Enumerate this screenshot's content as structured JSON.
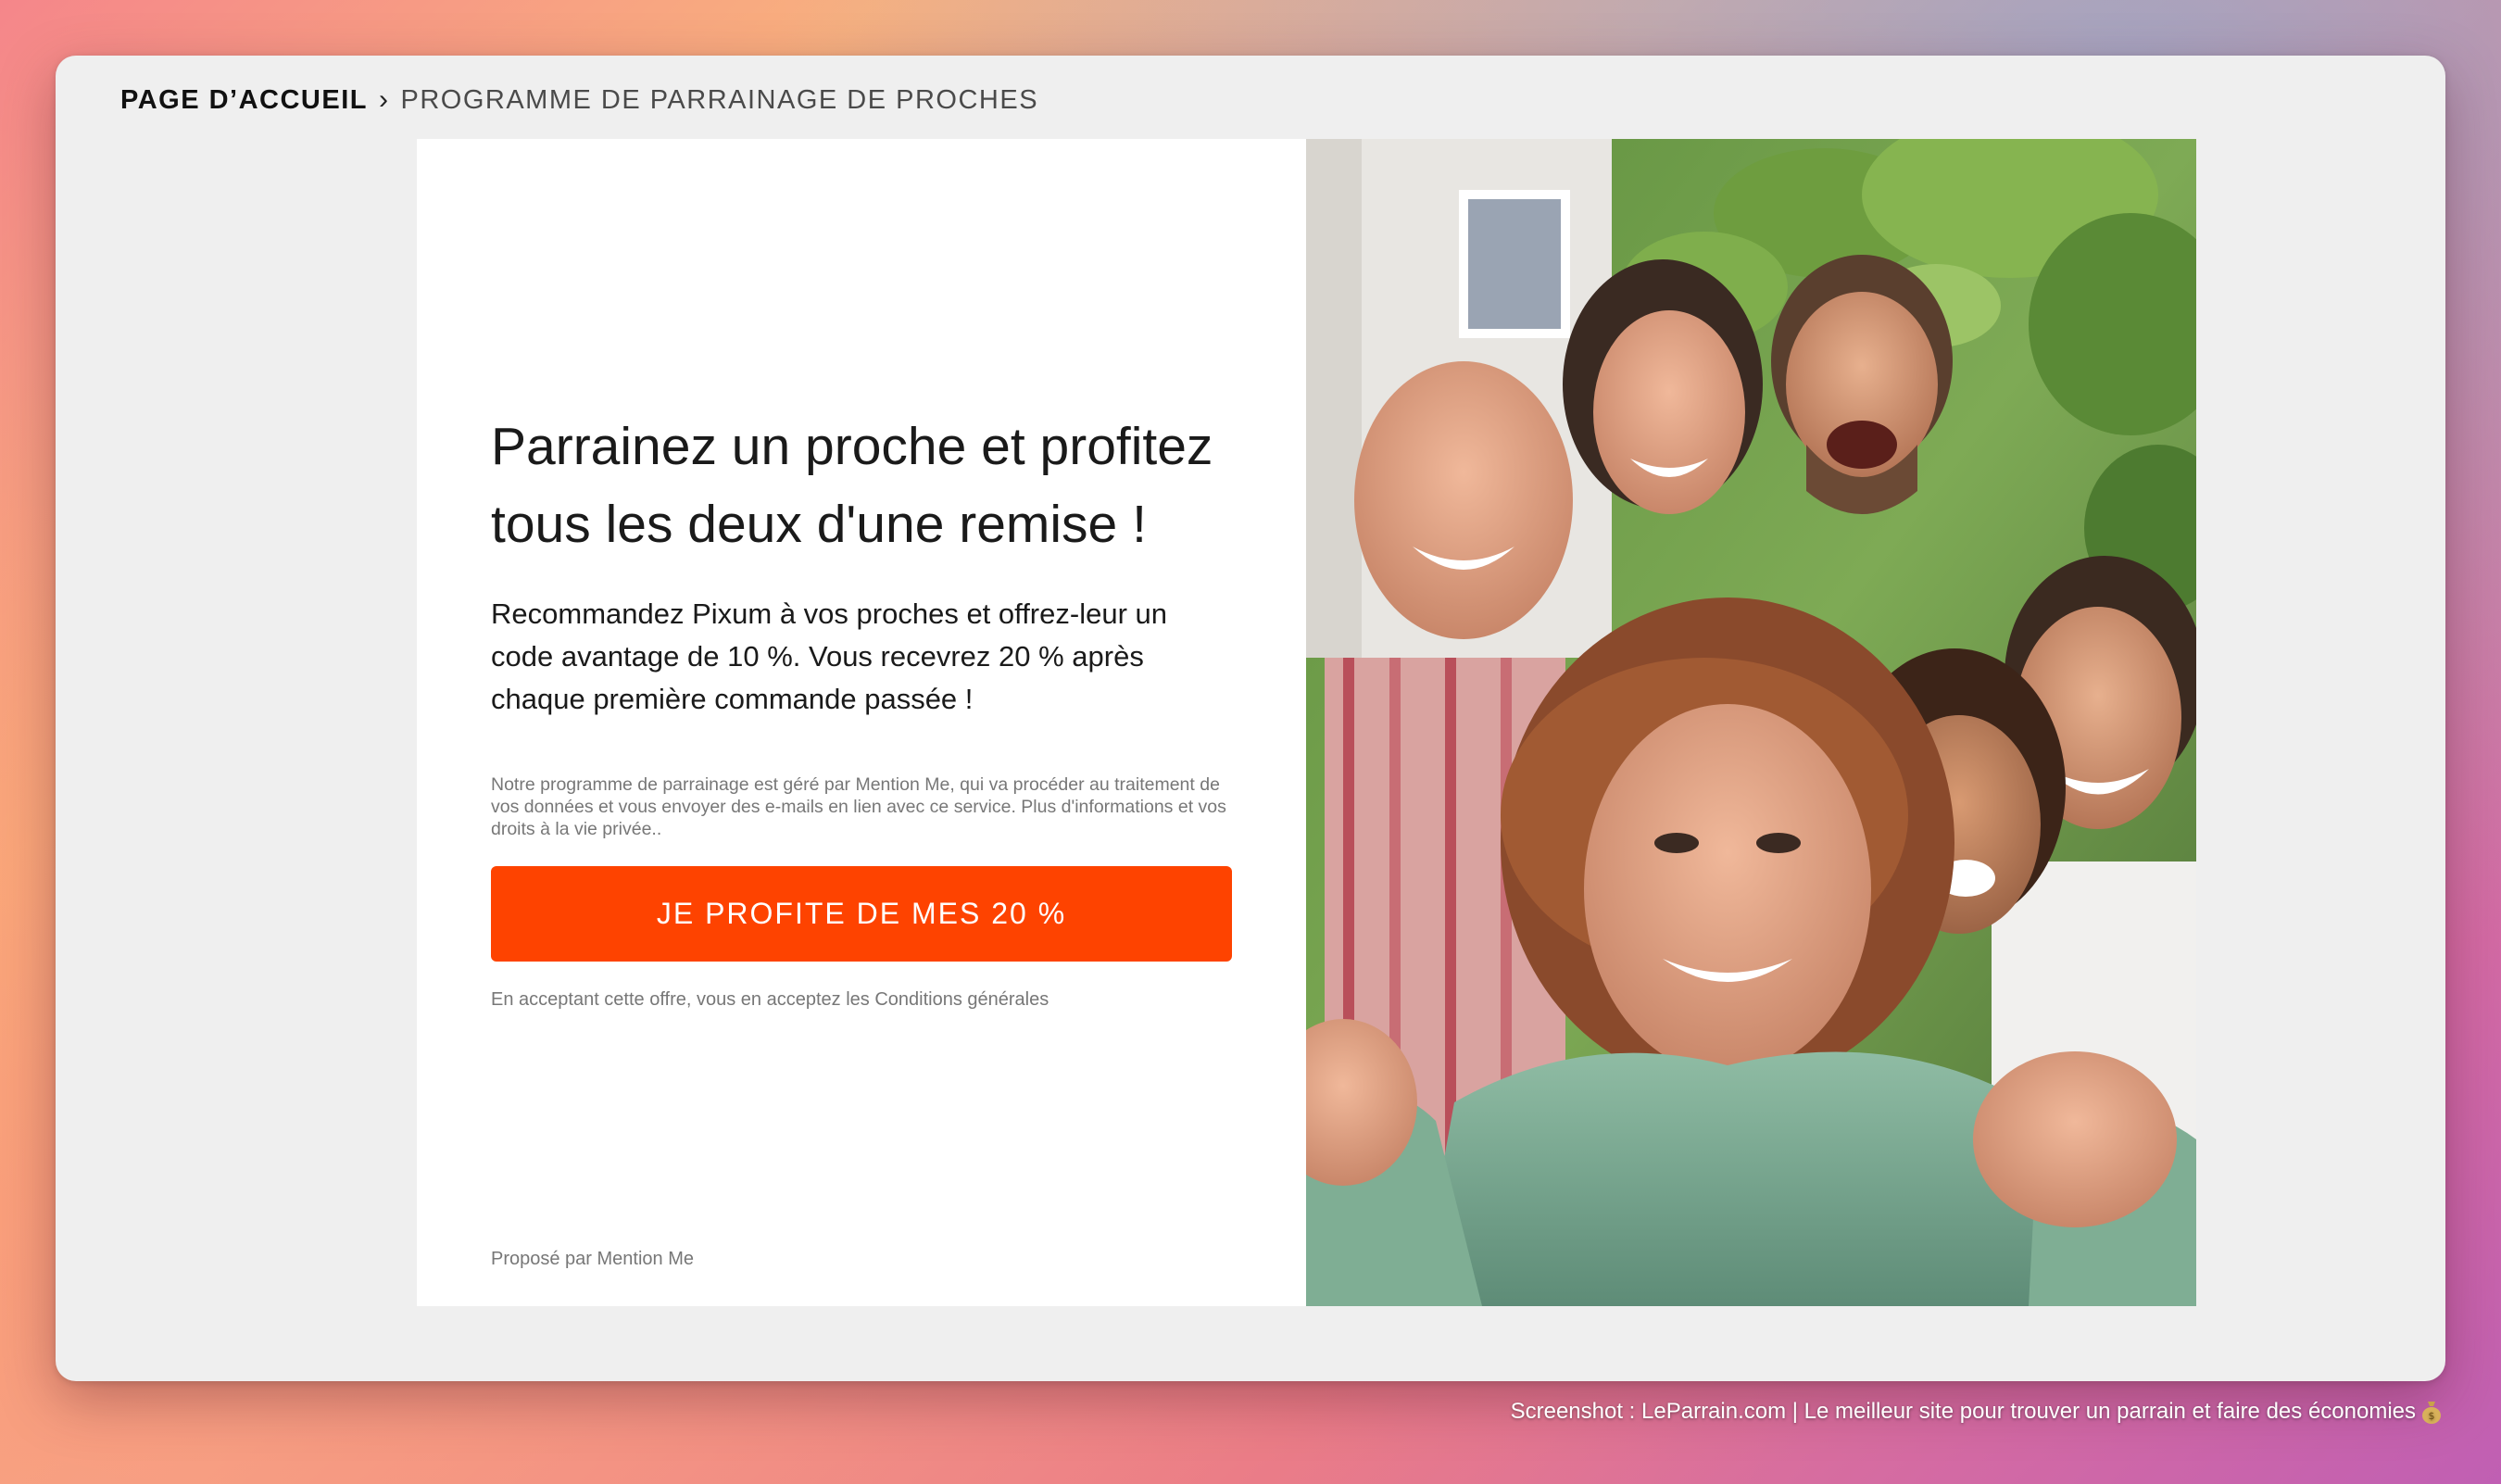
{
  "breadcrumb": {
    "home": "PAGE D’ACCUEIL",
    "separator": "›",
    "current": "PROGRAMME DE PARRAINAGE DE PROCHES"
  },
  "hero": {
    "headline": "Parrainez un proche et profitez tous les deux d'une remise !",
    "subtext": "Recommandez Pixum à vos proches et offrez-leur un code avantage de 10 %. Vous recevrez 20 % après chaque première commande passée !",
    "legal": "Notre programme de parrainage est géré par Mention Me, qui va procéder au traitement de vos données et vous envoyer des e-mails en lien avec ce service. Plus d'informations et vos droits à la vie privée..",
    "cta_label": "JE PROFITE DE MES 20 %",
    "terms": "En acceptant cette offre, vous en acceptez les Conditions générales",
    "powered_by": "Proposé par Mention Me"
  },
  "photo": {
    "icon": "group-selfie-photo"
  },
  "caption": {
    "text": "Screenshot : LeParrain.com | Le meilleur site pour trouver un parrain et faire des économies",
    "icon": "money-bag-icon"
  },
  "colors": {
    "accent": "#fe4300",
    "window_bg": "#efefef",
    "panel_bg": "#ffffff"
  }
}
